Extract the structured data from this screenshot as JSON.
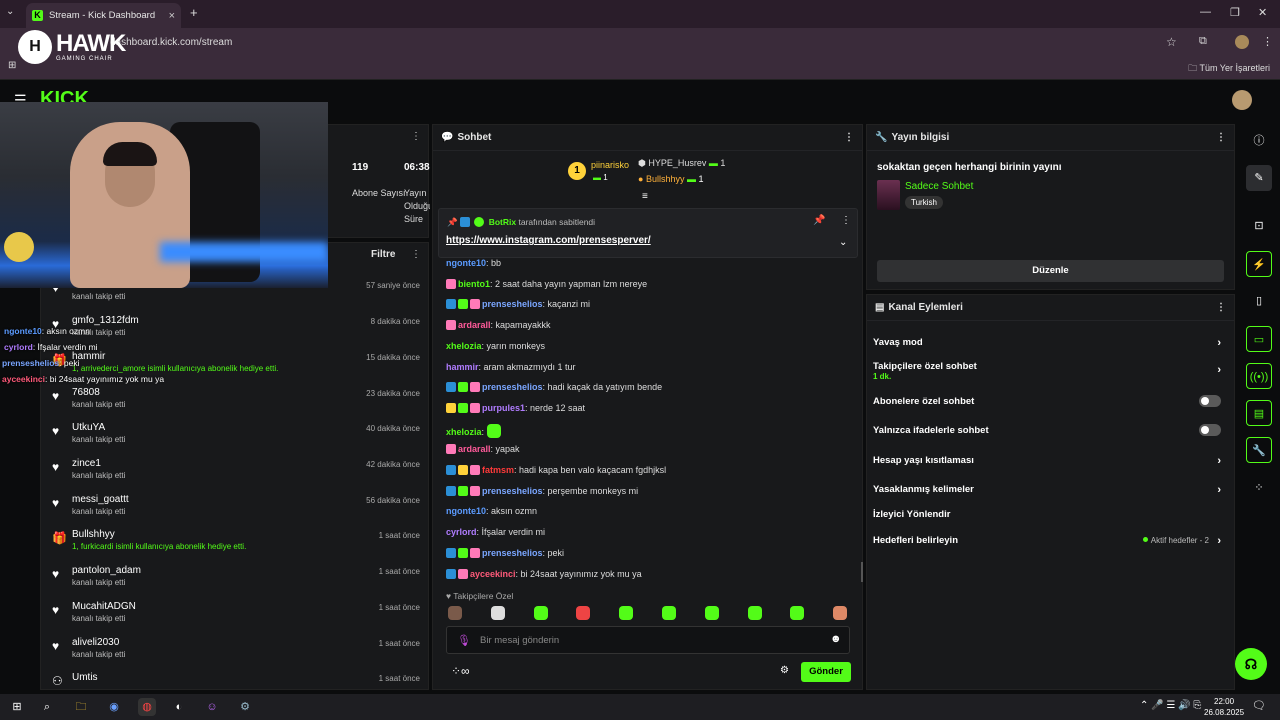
{
  "browser": {
    "tab_title": "Stream - Kick Dashboard",
    "url": "dashboard.kick.com/stream",
    "bookmarks_label": "Tüm Yer İşaretleri"
  },
  "overlay_logo": {
    "brand": "HAWK",
    "tagline": "GAMING CHAIR"
  },
  "kick_logo": "KICK",
  "stats": [
    {
      "value": "119",
      "label": "Abone Sayısı"
    },
    {
      "value": "06:38",
      "label": "Yayın Olduğu Süre"
    }
  ],
  "events": {
    "filter_label": "Filtre",
    "items": [
      {
        "name": "",
        "sub": "kanalı takip etti",
        "time": "57 saniye önce",
        "icon": "heart-icon",
        "gift": false
      },
      {
        "name": "gmfo_1312fdm",
        "sub": "kanalı takip etti",
        "time": "8 dakika önce",
        "icon": "heart-icon",
        "gift": false
      },
      {
        "name": "hammir",
        "sub": "1, arrivederci_amore isimli kullanıcıya abonelik hediye etti.",
        "time": "15 dakika önce",
        "icon": "gift-icon",
        "gift": true
      },
      {
        "name": "76808",
        "sub": "kanalı takip etti",
        "time": "23 dakika önce",
        "icon": "heart-icon",
        "gift": false
      },
      {
        "name": "UtkuYA",
        "sub": "kanalı takip etti",
        "time": "40 dakika önce",
        "icon": "heart-icon",
        "gift": false
      },
      {
        "name": "zince1",
        "sub": "kanalı takip etti",
        "time": "42 dakika önce",
        "icon": "heart-icon",
        "gift": false
      },
      {
        "name": "messi_goattt",
        "sub": "kanalı takip etti",
        "time": "56 dakika önce",
        "icon": "heart-icon",
        "gift": false
      },
      {
        "name": "Bullshhyy",
        "sub": "1, furkicardi isimli kullanıcıya abonelik hediye etti.",
        "time": "1 saat önce",
        "icon": "gift-icon",
        "gift": true
      },
      {
        "name": "pantolon_adam",
        "sub": "kanalı takip etti",
        "time": "1 saat önce",
        "icon": "heart-icon",
        "gift": false
      },
      {
        "name": "MucahitADGN",
        "sub": "kanalı takip etti",
        "time": "1 saat önce",
        "icon": "heart-icon",
        "gift": false
      },
      {
        "name": "aliveli2030",
        "sub": "kanalı takip etti",
        "time": "1 saat önce",
        "icon": "heart-icon",
        "gift": false
      },
      {
        "name": "Umtis",
        "sub": "",
        "time": "1 saat önce",
        "icon": "user-icon",
        "gift": false
      }
    ]
  },
  "overlay_chat": [
    {
      "user": "ngonte10",
      "text": ": aksın ozmn",
      "color": "#5b9bff"
    },
    {
      "user": "cyrlord",
      "text": ": İfşalar verdin mi",
      "color": "#b07cff"
    },
    {
      "user": "prenseshelios",
      "text": ": peki",
      "color": "#7aa6ff"
    },
    {
      "user": "ayceekinci",
      "text": ": bi 24saat yayınımız yok mu ya",
      "color": "#ff5a7a"
    }
  ],
  "chat": {
    "title": "Sohbet",
    "top_gifters": [
      {
        "name": "piinarisko",
        "count": "1",
        "color": "#ffd23a"
      },
      {
        "name": "HYPE_Husrev",
        "count": "1",
        "color": "#dddddd"
      },
      {
        "name": "Bullshhyy",
        "count": "1",
        "color": "#ffb13a"
      }
    ],
    "pinned": {
      "by_user": "BotRix",
      "by_text": "tarafından sabitlendi",
      "link": "https://www.instagram.com/prensesperver/"
    },
    "messages": [
      {
        "user": "ngonte10",
        "color": "#5b9bff",
        "text": ": bb",
        "emote": false
      },
      {
        "user": "biento1",
        "color": "#53fc18",
        "text": ": 2 saat daha yayın yapman lzm nereye",
        "emote": false
      },
      {
        "user": "prenseshelios",
        "color": "#7aa6ff",
        "text": ": kaçanzi mi",
        "emote": false
      },
      {
        "user": "ardarall",
        "color": "#ff5a9a",
        "text": ": kapamayakkk",
        "emote": false
      },
      {
        "user": "xhelozia",
        "color": "#53fc18",
        "text": ": yarın monkeys",
        "emote": false
      },
      {
        "user": "hammir",
        "color": "#b07cff",
        "text": ": aram akmazmıydı 1 tur",
        "emote": false
      },
      {
        "user": "prenseshelios",
        "color": "#7aa6ff",
        "text": ": hadi kaçak da yatıyım bende",
        "emote": false
      },
      {
        "user": "purpules1",
        "color": "#b07cff",
        "text": ": nerde 12 saat",
        "emote": false
      },
      {
        "user": "xhelozia",
        "color": "#53fc18",
        "text": ":",
        "emote": true
      },
      {
        "user": "ardarall",
        "color": "#ff5a9a",
        "text": ": yapak",
        "emote": false
      },
      {
        "user": "fatmsm",
        "color": "#ff3a3a",
        "text": ": hadi kapa ben valo kaçacam fgdhjksl",
        "emote": false
      },
      {
        "user": "prenseshelios",
        "color": "#7aa6ff",
        "text": ": perşembe monkeys mi",
        "emote": false
      },
      {
        "user": "ngonte10",
        "color": "#5b9bff",
        "text": ": aksın ozmn",
        "emote": false
      },
      {
        "user": "cyrlord",
        "color": "#b07cff",
        "text": ": İfşalar verdin mi",
        "emote": false
      },
      {
        "user": "prenseshelios",
        "color": "#7aa6ff",
        "text": ": peki",
        "emote": false
      },
      {
        "user": "ayceekinci",
        "color": "#ff5a7a",
        "text": ": bi 24saat yayınımız yok mu ya",
        "emote": false
      }
    ],
    "followers_only_label": "Takipçilere Özel",
    "input_placeholder": "Bir mesaj gönderin",
    "send_label": "Gönder"
  },
  "stream_info": {
    "title": "Yayın bilgisi",
    "stream_title": "sokaktan geçen herhangi birinin yayını",
    "category": "Sadece Sohbet",
    "tag": "Turkish",
    "edit_label": "Düzenle"
  },
  "channel_actions": {
    "title": "Kanal Eylemleri",
    "items": [
      {
        "label": "Yavaş mod",
        "control": "chevron"
      },
      {
        "label": "Takipçilere özel sohbet",
        "sub": "1 dk.",
        "control": "chevron"
      },
      {
        "label": "Abonelere özel sohbet",
        "control": "toggle",
        "on": false
      },
      {
        "label": "Yalnızca ifadelerle sohbet",
        "control": "toggle",
        "on": false
      },
      {
        "label": "Hesap yaşı kısıtlaması",
        "control": "chevron"
      },
      {
        "label": "Yasaklanmış kelimeler",
        "control": "chevron"
      },
      {
        "label": "İzleyici Yönlendir",
        "control": "none"
      },
      {
        "label": "Hedefleri belirleyin",
        "control": "chevron",
        "right_text": "Aktif hedefler - 2"
      }
    ]
  },
  "taskbar": {
    "time": "22:00",
    "date": "26.08.2025"
  },
  "colors": {
    "accent": "#53fc18",
    "panel": "#18191b",
    "bg": "#0b0c0d"
  }
}
